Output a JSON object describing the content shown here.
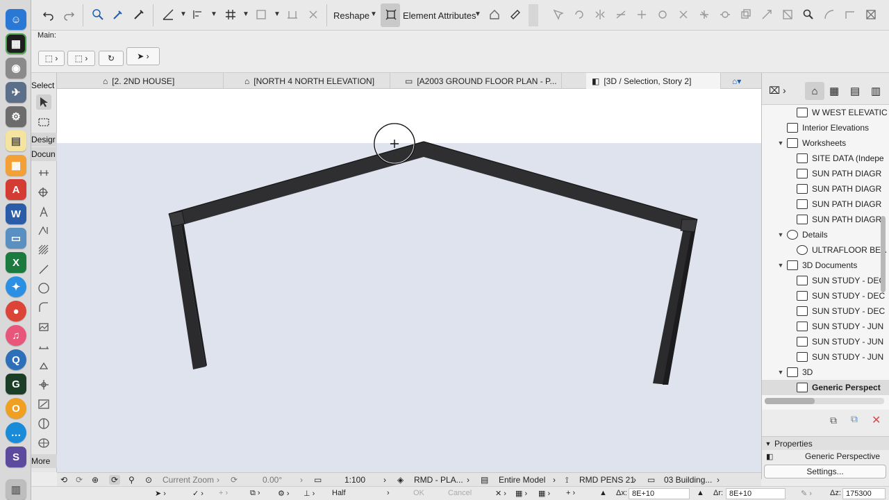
{
  "toolbar": {
    "reshape_label": "Reshape",
    "element_attributes_label": "Element Attributes"
  },
  "infobox": {
    "main_label": "Main:"
  },
  "toolbox": {
    "select_label": "Select",
    "design_label": "Desigr",
    "document_label": "Docun",
    "more_label": "More"
  },
  "tabs": [
    {
      "label": "[2. 2ND HOUSE]"
    },
    {
      "label": "[NORTH 4 NORTH ELEVATION]"
    },
    {
      "label": "[A2003 GROUND FLOOR PLAN - P..."
    },
    {
      "label": "[3D / Selection, Story 2]"
    }
  ],
  "navigator": {
    "items": [
      {
        "label": "W WEST ELEVATIC"
      },
      {
        "label": "Interior Elevations"
      },
      {
        "label": "Worksheets"
      },
      {
        "label": "SITE DATA (Indepe"
      },
      {
        "label": "SUN PATH DIAGR"
      },
      {
        "label": "SUN PATH DIAGR"
      },
      {
        "label": "SUN PATH DIAGR"
      },
      {
        "label": "SUN PATH DIAGR"
      },
      {
        "label": "Details"
      },
      {
        "label": "ULTRAFLOOR BEA"
      },
      {
        "label": "3D Documents"
      },
      {
        "label": "SUN STUDY - DEC"
      },
      {
        "label": "SUN STUDY - DEC"
      },
      {
        "label": "SUN STUDY - DEC"
      },
      {
        "label": "SUN STUDY - JUN"
      },
      {
        "label": "SUN STUDY - JUN"
      },
      {
        "label": "SUN STUDY - JUN"
      },
      {
        "label": "3D"
      },
      {
        "label": "Generic Perspect"
      }
    ]
  },
  "properties": {
    "header": "Properties",
    "name": "Generic Perspective",
    "settings_label": "Settings..."
  },
  "statusbar": {
    "zoom_label": "Current Zoom",
    "angle": "0.00°",
    "scale": "1:100",
    "layer": "RMD - PLA...",
    "model": "Entire Model",
    "pen": "RMD PENS 21",
    "building": "03 Building..."
  },
  "controlbar": {
    "half_label": "Half",
    "ok_label": "OK",
    "cancel_label": "Cancel",
    "dx_label": "Δx:",
    "dx_value": "8E+10",
    "dr_label": "Δr:",
    "dr_value": "8E+10",
    "dz_label": "Δz:",
    "dz_value": "175300"
  },
  "colors": {
    "frame": "#2b2b2d",
    "ground": "#dfe3ee",
    "sky": "#ffffff"
  }
}
